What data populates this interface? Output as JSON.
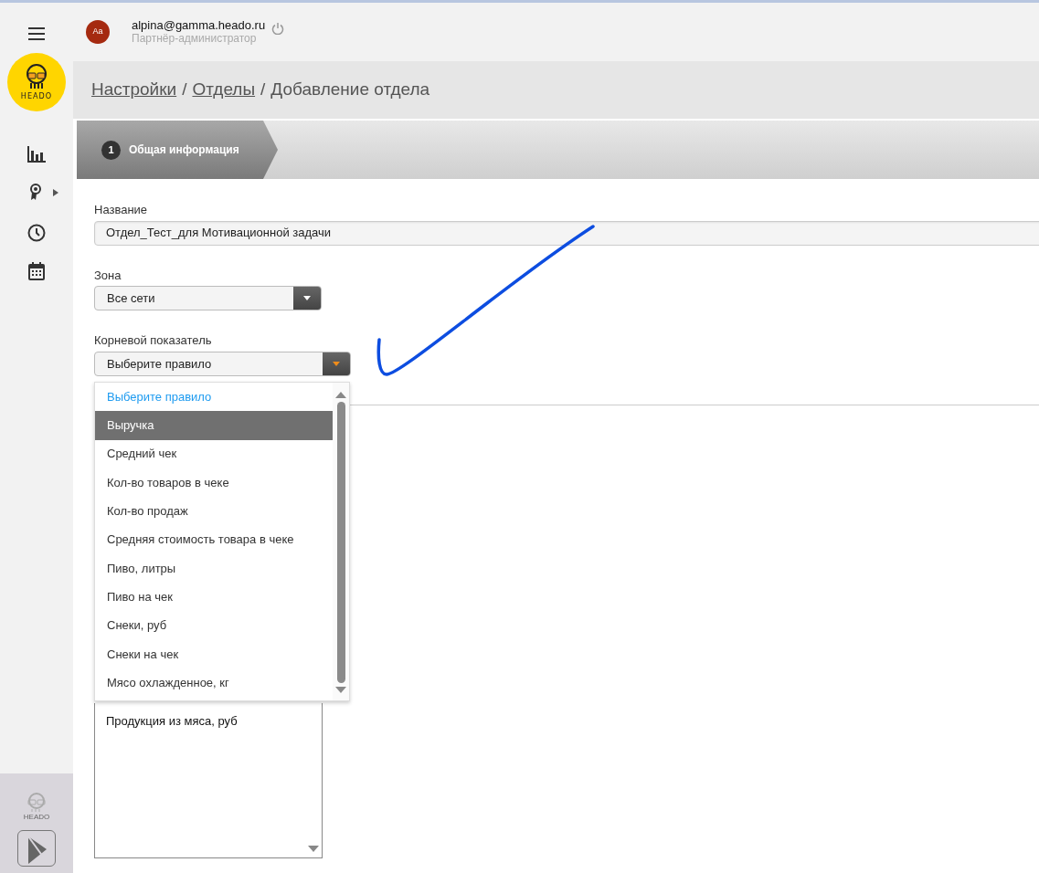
{
  "logo": {
    "text": "HEADO"
  },
  "user": {
    "avatar": "Aa",
    "email": "alpina@gamma.heado.ru",
    "role": "Партнёр-администратор"
  },
  "breadcrumb": {
    "separator": "/",
    "items": [
      {
        "label": "Настройки",
        "link": true
      },
      {
        "label": "Отделы",
        "link": true
      },
      {
        "label": "Добавление отдела",
        "link": false
      }
    ]
  },
  "wizard_steps": [
    {
      "number": "1",
      "label": "Общая информация",
      "selected": true
    }
  ],
  "form": {
    "name": {
      "label": "Название",
      "value": "Отдел_Тест_для Мотивационной задачи"
    },
    "zone": {
      "label": "Зона",
      "value": "Все сети"
    },
    "root_metric": {
      "label": "Корневой показатель",
      "value": "Выберите правило",
      "expanded": true,
      "options": [
        {
          "label": "Выберите правило",
          "selected": true,
          "highlighted": false
        },
        {
          "label": "Выручка",
          "selected": false,
          "highlighted": true
        },
        {
          "label": "Средний чек",
          "selected": false,
          "highlighted": false
        },
        {
          "label": "Кол-во товаров в чеке",
          "selected": false,
          "highlighted": false
        },
        {
          "label": "Кол-во продаж",
          "selected": false,
          "highlighted": false
        },
        {
          "label": "Средняя стоимость товара в чеке",
          "selected": false,
          "highlighted": false
        },
        {
          "label": "Пиво, литры",
          "selected": false,
          "highlighted": false
        },
        {
          "label": "Пиво на чек",
          "selected": false,
          "highlighted": false
        },
        {
          "label": "Снеки, руб",
          "selected": false,
          "highlighted": false
        },
        {
          "label": "Снеки на чек",
          "selected": false,
          "highlighted": false
        },
        {
          "label": "Мясо охлажденное, кг",
          "selected": false,
          "highlighted": false
        }
      ]
    },
    "listbox": {
      "items": [
        "Продукция из мяса, руб"
      ]
    }
  },
  "footer_logo": {
    "text": "HEADO"
  }
}
